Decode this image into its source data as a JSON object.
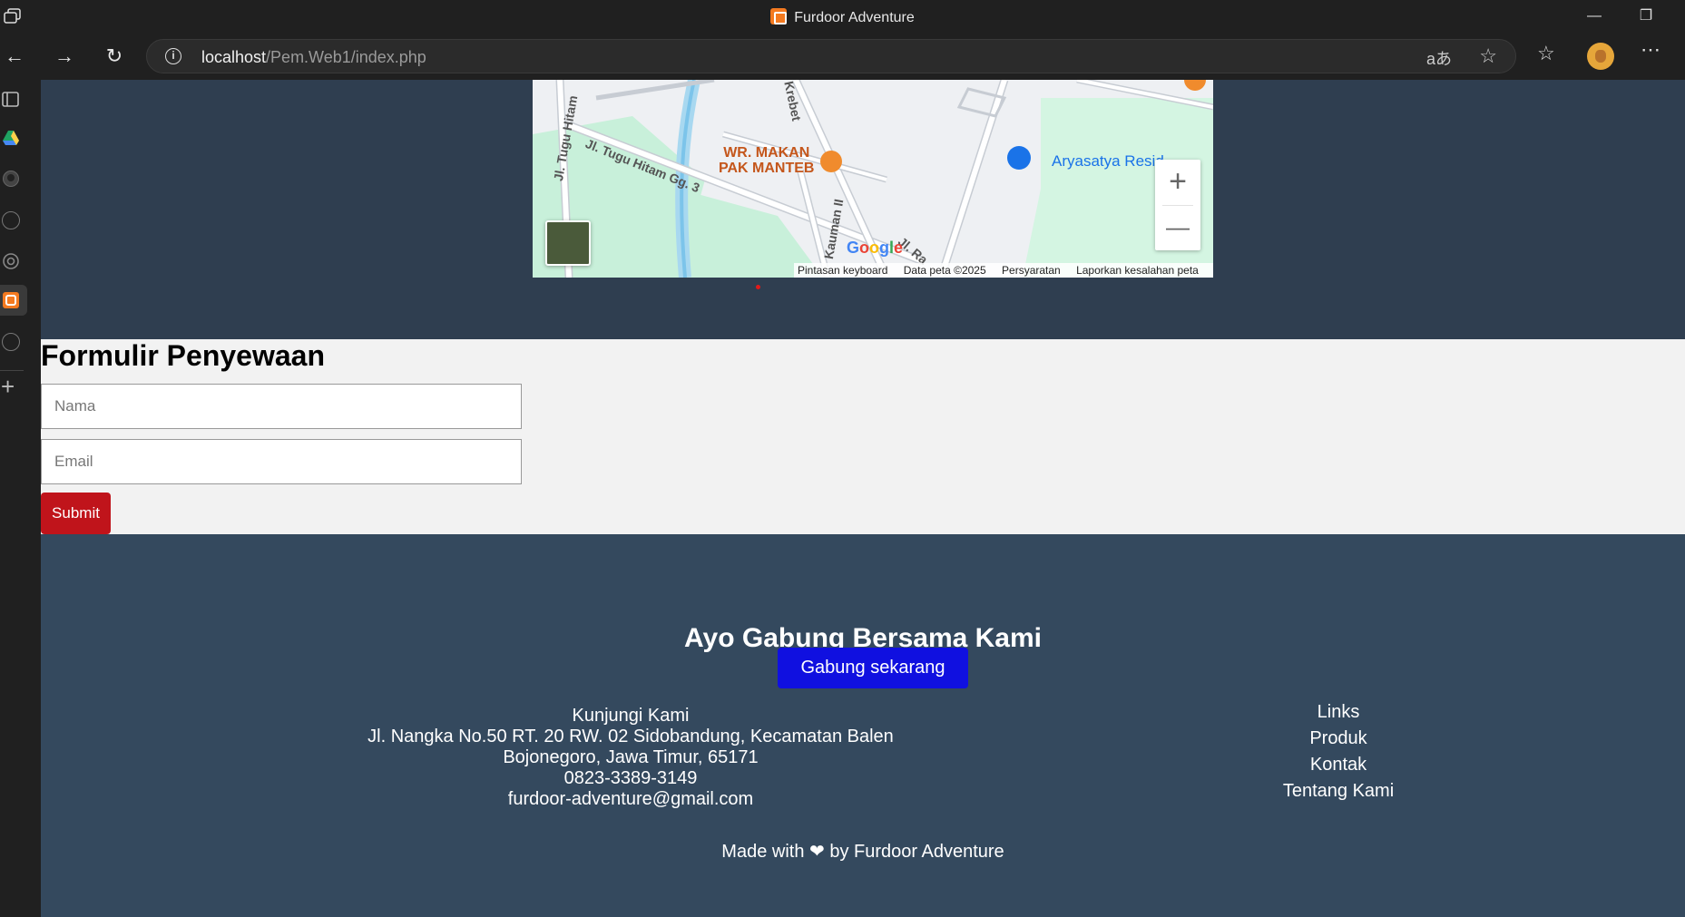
{
  "window": {
    "title": "Furdoor Adventure"
  },
  "address_bar": {
    "url_host": "localhost",
    "url_path": "/Pem.Web1/index.php"
  },
  "map": {
    "poi_name_line1": "WR. MAKAN",
    "poi_name_line2": "PAK MANTEB",
    "residence_label": "Aryasatya Resid",
    "roads": [
      "Jl. Tugu Hitam",
      "Jl. Tugu Hitam Gg. 3",
      "Krebet",
      "Kauman II",
      "Jl. Ra"
    ],
    "google_logo": "Google",
    "attribution": [
      "Pintasan keyboard",
      "Data peta ©2025",
      "Persyaratan",
      "Laporkan kesalahan peta"
    ],
    "zoom_in": "+",
    "zoom_out": "—"
  },
  "form": {
    "title": "Formulir Penyewaan",
    "name_placeholder": "Nama",
    "email_placeholder": "Email",
    "submit_label": "Submit"
  },
  "footer": {
    "join_heading": "Ayo Gabung Bersama Kami",
    "join_button": "Gabung sekarang",
    "visit": {
      "title": "Kunjungi Kami",
      "address_line1": "Jl. Nangka No.50 RT. 20 RW. 02 Sidobandung, Kecamatan Balen",
      "address_line2": "Bojonegoro, Jawa Timur, 65171",
      "phone": "0823-3389-3149",
      "email": "furdoor-adventure@gmail.com"
    },
    "links": {
      "title": "Links",
      "items": [
        "Produk",
        "Kontak",
        "Tentang Kami"
      ]
    },
    "credit_prefix": "Made with",
    "credit_suffix": "by Furdoor Adventure"
  },
  "colors": {
    "page_bg": "#2f3e50",
    "footer_bg": "#34495e",
    "submit_bg": "#c0141b",
    "join_button_bg": "#1010e0",
    "form_bg": "#f2f2f2"
  }
}
